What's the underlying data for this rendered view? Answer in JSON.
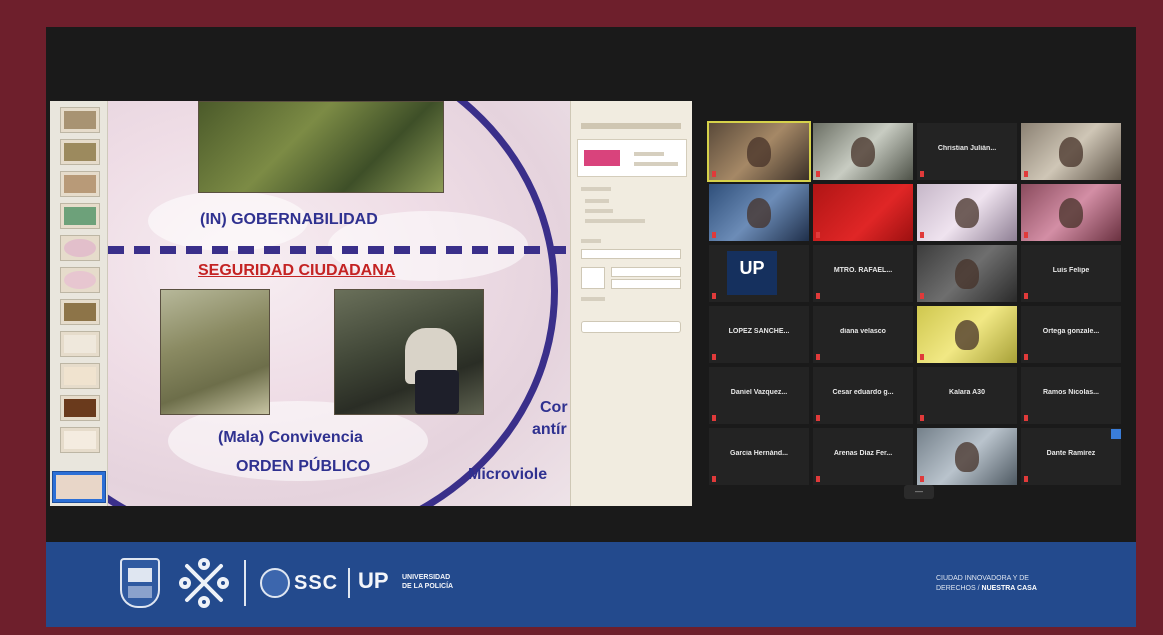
{
  "slide": {
    "line1": "(IN) GOBERNABILIDAD",
    "line2": "SEGURIDAD CIUDADANA",
    "line3": "(Mala) Convivencia",
    "line4": "ORDEN PÚBLICO",
    "partial1": "Cor",
    "partial2": "antír",
    "partial3": "Microviole"
  },
  "participants": [
    {
      "name": "",
      "video": true
    },
    {
      "name": "",
      "video": true
    },
    {
      "name": "Christian Julián...",
      "video": false
    },
    {
      "name": "",
      "video": true
    },
    {
      "name": "",
      "video": true
    },
    {
      "name": "",
      "video": true
    },
    {
      "name": "",
      "video": true
    },
    {
      "name": "",
      "video": true
    },
    {
      "name": "",
      "video": true,
      "logo": "UP"
    },
    {
      "name": "MTRO. RAFAEL...",
      "video": false
    },
    {
      "name": "",
      "video": true
    },
    {
      "name": "Luis Felipe",
      "video": false
    },
    {
      "name": "LOPEZ SANCHE...",
      "video": false
    },
    {
      "name": "diana velasco",
      "video": false
    },
    {
      "name": "",
      "video": true
    },
    {
      "name": "Ortega gonzale...",
      "video": false
    },
    {
      "name": "Daniel Vazquez...",
      "video": false
    },
    {
      "name": "Cesar eduardo g...",
      "video": false
    },
    {
      "name": "Kalara A30",
      "video": false
    },
    {
      "name": "Ramos Nicolas...",
      "video": false
    },
    {
      "name": "Garcia Hernánd...",
      "video": false
    },
    {
      "name": "Arenas Díaz Fer...",
      "video": false
    },
    {
      "name": "",
      "video": true
    },
    {
      "name": "Dante Ramírez",
      "video": false
    }
  ],
  "footer": {
    "ssc": "SSC",
    "up": "UP",
    "universidad_line1": "UNIVERSIDAD",
    "universidad_line2": "DE LA POLICÍA",
    "city_line1": "CIUDAD INNOVADORA Y DE",
    "city_line2a": "DERECHOS / ",
    "city_line2b": "NUESTRA CASA"
  },
  "colors": {
    "frame": "#6e1f2c",
    "footer": "#234a8d",
    "slide_text": "#2f3190",
    "slide_accent": "#c42323",
    "active_speaker": "#d6d24a"
  }
}
